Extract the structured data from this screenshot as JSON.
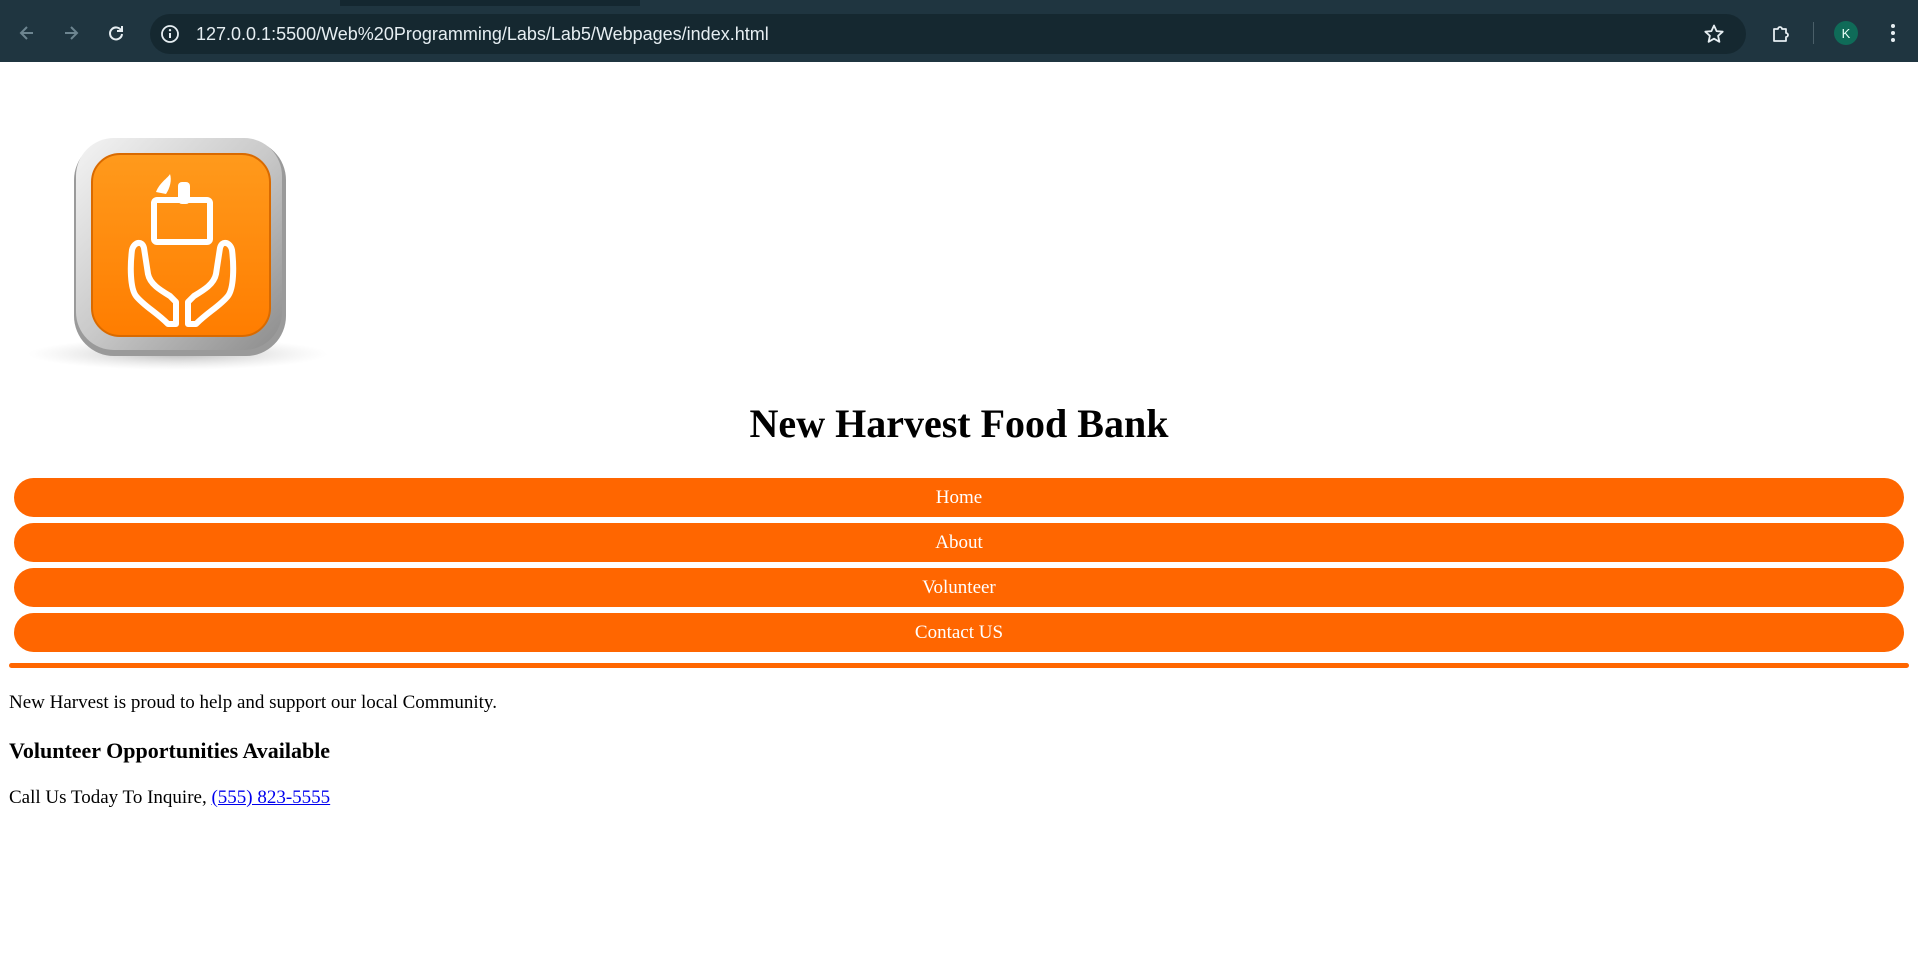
{
  "browser": {
    "url": "127.0.0.1:5500/Web%20Programming/Labs/Lab5/Webpages/index.html",
    "avatar_initial": "K",
    "icons": {
      "back": "arrow-left-icon",
      "forward": "arrow-right-icon",
      "reload": "reload-icon",
      "site_info": "info-icon",
      "bookmark": "star-icon",
      "extensions": "puzzle-icon",
      "menu": "kebab-menu-icon"
    }
  },
  "site": {
    "logo_icon": "food-donation-hands-icon",
    "title": "New Harvest Food Bank",
    "nav": [
      {
        "label": "Home"
      },
      {
        "label": "About"
      },
      {
        "label": "Volunteer"
      },
      {
        "label": "Contact US"
      }
    ],
    "intro": "New Harvest is proud to help and support our local Community.",
    "volunteer_heading": "Volunteer Opportunities Available",
    "call_text": "Call Us Today To Inquire, ",
    "phone": "(555) 823-5555"
  },
  "colors": {
    "accent": "#ff6600",
    "chrome_bg": "#1f3540",
    "link": "#0000ee"
  }
}
